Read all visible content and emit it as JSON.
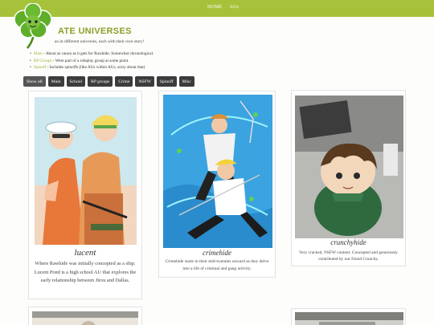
{
  "nav": {
    "home": "HOME",
    "aus": "AUs"
  },
  "site": {
    "title": "ATE UNIVERSES",
    "tagline": "au in different universes, each with their own story!"
  },
  "legend": [
    {
      "category": "Main",
      "text": " - About as canon as it gets for Rawhide. Somewhat chronological."
    },
    {
      "category": "RP Groups",
      "text": " - Were part of a roleplay group at some point."
    },
    {
      "category": "Spinoff",
      "text": " - Includes spinoffs (like AUs within AUs, sorry about that)"
    }
  ],
  "filters": [
    "Show all",
    "Main",
    "School",
    "RP groups",
    "Crime",
    "NSFW",
    "Spinoff",
    "Misc"
  ],
  "cards": [
    {
      "title": "lucent",
      "desc": "Where Rawhide was initially concepted as a ship. Lucent Pond is a high school AU that explores the early relationship between Jirou and Dallas."
    },
    {
      "title": "crimehide",
      "desc": "Crimehide starts in their mid-twenties onward as they delve into a life of criminal and gang activity."
    },
    {
      "title": "crunchyhide",
      "desc": "Very cracked, NSFW content. Concepted and generously contributed by our friend Crunchy."
    }
  ],
  "colors": {
    "accent": "#a6c23a",
    "title": "#8aa12a",
    "button": "#3c3c3c"
  }
}
